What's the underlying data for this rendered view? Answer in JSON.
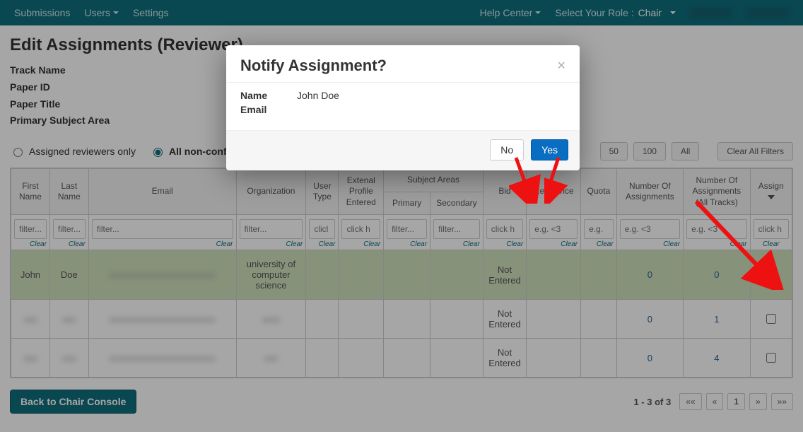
{
  "nav": {
    "left": [
      "Submissions",
      "Users",
      "Settings"
    ],
    "help": "Help Center",
    "roleLabel": "Select Your Role :",
    "roleValue": "Chair"
  },
  "page": {
    "title": "Edit Assignments (Reviewer)",
    "meta": [
      "Track Name",
      "Paper ID",
      "Paper Title",
      "Primary Subject Area"
    ]
  },
  "filters": {
    "assignedOnly": "Assigned reviewers only",
    "allNonConflict": "All non-conflict",
    "pageSizes": [
      "50",
      "100",
      "All"
    ],
    "clearAll": "Clear All Filters"
  },
  "table": {
    "headers": {
      "firstName": "First Name",
      "lastName": "Last Name",
      "email": "Email",
      "organization": "Organization",
      "userType": "User Type",
      "extProfile": "Extenal Profile Entered",
      "subjectAreas": "Subject Areas",
      "primary": "Primary",
      "secondary": "Secondary",
      "bid": "Bid",
      "relevance": "Relevance",
      "quota": "Quota",
      "numAssign": "Number Of Assignments",
      "numAssignAll": "Number Of Assignments (All Tracks)",
      "assign": "Assign"
    },
    "filterPlaceholders": {
      "text": "filter...",
      "click": "click h",
      "clickShort": "clicl",
      "eg3": "e.g. <3",
      "egShort": "e.g."
    },
    "clearLabel": "Clear",
    "rows": [
      {
        "firstName": "John",
        "lastName": "Doe",
        "email": "",
        "organization": "university of computer science",
        "bid": "Not Entered",
        "numAssign": "0",
        "numAssignAll": "0",
        "assigned": true,
        "highlight": true
      },
      {
        "firstName": "",
        "lastName": "",
        "email": "",
        "organization": "",
        "bid": "Not Entered",
        "numAssign": "0",
        "numAssignAll": "1",
        "assigned": false,
        "highlight": false
      },
      {
        "firstName": "",
        "lastName": "",
        "email": "",
        "organization": "",
        "bid": "Not Entered",
        "numAssign": "0",
        "numAssignAll": "4",
        "assigned": false,
        "highlight": false
      }
    ]
  },
  "footer": {
    "back": "Back to Chair Console",
    "rangeText": "1 - 3 of 3",
    "pager": {
      "first": "««",
      "prev": "«",
      "page": "1",
      "next": "»",
      "last": "»»"
    }
  },
  "modal": {
    "title": "Notify Assignment?",
    "nameLabel": "Name",
    "nameValue": "John Doe",
    "emailLabel": "Email",
    "no": "No",
    "yes": "Yes"
  }
}
